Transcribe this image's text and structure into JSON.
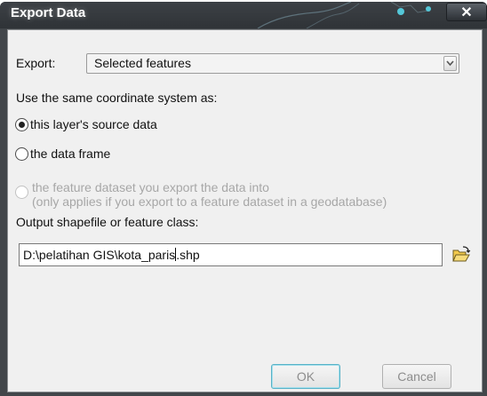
{
  "window": {
    "title": "Export Data",
    "close_glyph": "✕"
  },
  "export": {
    "label": "Export:",
    "selected": "Selected features"
  },
  "coordinate": {
    "heading": "Use the same coordinate system as:",
    "options": [
      {
        "label": "this layer's source data",
        "checked": true,
        "enabled": true
      },
      {
        "label": "the data frame",
        "checked": false,
        "enabled": true
      },
      {
        "label": "the feature dataset you export the data into",
        "sublabel": "(only applies if you export to a feature dataset in a geodatabase)",
        "checked": false,
        "enabled": false
      }
    ]
  },
  "output": {
    "label": "Output shapefile or feature class:",
    "value_before_caret": "D:\\pelatihan GIS\\kota_paris",
    "value_after_caret": ".shp"
  },
  "buttons": {
    "ok": "OK",
    "cancel": "Cancel"
  },
  "icons": {
    "combo_arrow": "chevron-down-icon",
    "browse": "open-folder-icon",
    "close": "close-icon"
  },
  "colors": {
    "title_bar": "#2f3337",
    "client_bg": "#f0f0f0",
    "ok_focus": "#57b2c7"
  }
}
